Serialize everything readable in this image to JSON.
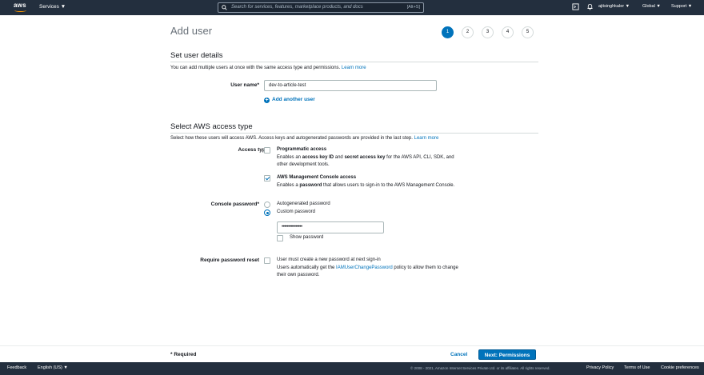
{
  "topnav": {
    "logo_text": "aws",
    "services_label": "Services ▼",
    "search_placeholder": "Search for services, features, marketplace products, and docs",
    "search_shortcut": "[Alt+S]",
    "user_label": "ajitsinghkaler ▼",
    "region_label": "Global ▼",
    "support_label": "Support ▼"
  },
  "header": {
    "title": "Add user",
    "steps": [
      "1",
      "2",
      "3",
      "4",
      "5"
    ],
    "active_step": 1
  },
  "user_details": {
    "section_title": "Set user details",
    "description": "You can add multiple users at once with the same access type and permissions.",
    "learn_more": "Learn more",
    "user_name_label": "User name*",
    "user_name_value": "dev-to-article-test",
    "add_another_user": "Add another user"
  },
  "access_type": {
    "section_title": "Select AWS access type",
    "description": "Select how these users will access AWS. Access keys and autogenerated passwords are provided in the last step.",
    "learn_more": "Learn more",
    "access_type_label": "Access type*",
    "programmatic": {
      "title": "Programmatic access",
      "line1_pre": "Enables an ",
      "line1_b1": "access key ID",
      "line1_mid": " and ",
      "line1_b2": "secret access key",
      "line1_post": " for the AWS API, CLI, SDK, and",
      "line2": "other development tools.",
      "checked": false
    },
    "console": {
      "title": "AWS Management Console access",
      "line1_pre": "Enables a ",
      "line1_b": "password",
      "line1_post": " that allows users to sign-in to the AWS Management Console.",
      "checked": true
    },
    "console_password_label": "Console password*",
    "autogenerated_label": "Autogenerated password",
    "custom_label": "Custom password",
    "custom_selected": true,
    "password_value": "••••••••••••••••",
    "show_password_label": "Show password",
    "reset_label": "Require password reset",
    "reset_line1": "User must create a new password at next sign-in",
    "reset_line2_pre": "Users automatically get the ",
    "reset_line2_link": "IAMUserChangePassword",
    "reset_line2_post": " policy to allow them to change",
    "reset_line3": "their own password."
  },
  "bottom": {
    "required_note": "* Required",
    "cancel_label": "Cancel",
    "next_label": "Next: Permissions"
  },
  "footer": {
    "feedback": "Feedback",
    "language": "English (US) ▼",
    "copyright": "© 2008 - 2021, Amazon Internet Services Private Ltd. or its affiliates. All rights reserved.",
    "privacy": "Privacy Policy",
    "terms": "Terms of Use",
    "cookies": "Cookie preferences"
  },
  "colors": {
    "nav_bg": "#232f3e",
    "accent": "#0073bb",
    "brand_orange": "#ff9900"
  }
}
